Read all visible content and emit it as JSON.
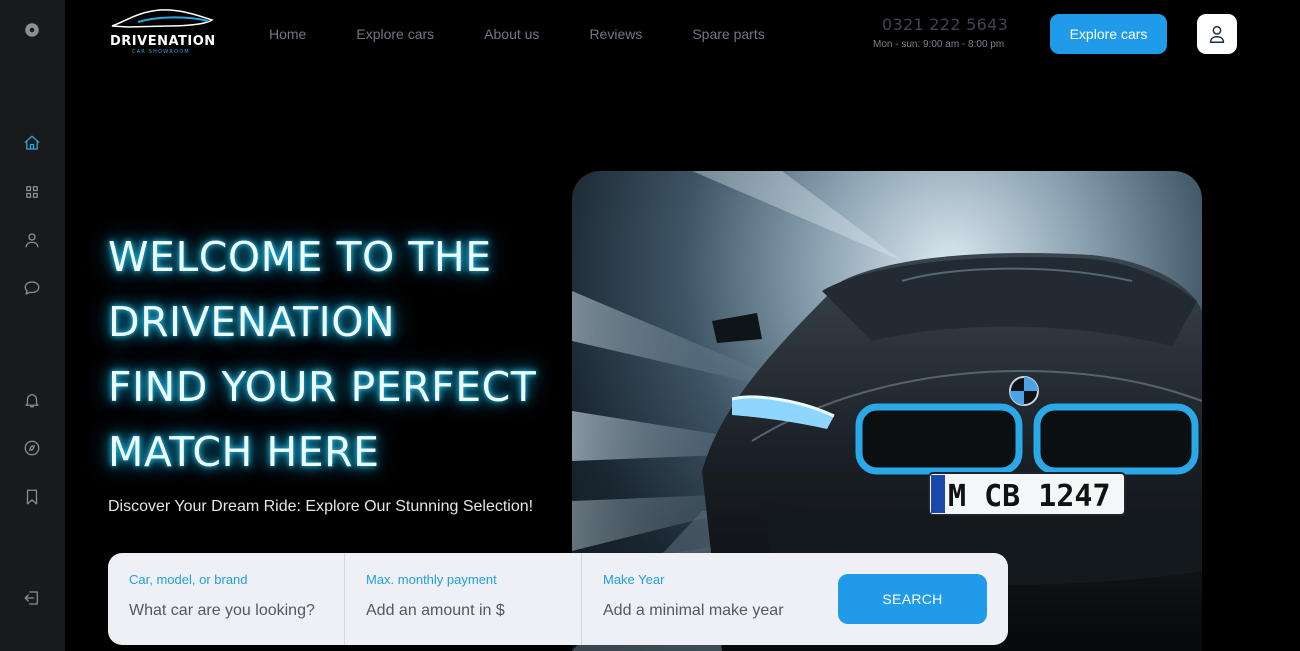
{
  "rail": {
    "top": [
      {
        "icon": "settings-dot-icon"
      }
    ],
    "middle": [
      {
        "icon": "home-icon",
        "active": true
      },
      {
        "icon": "grid-icon"
      },
      {
        "icon": "user-icon"
      },
      {
        "icon": "chat-icon"
      }
    ],
    "lower": [
      {
        "icon": "bell-icon"
      },
      {
        "icon": "compass-icon"
      },
      {
        "icon": "bookmark-icon"
      }
    ],
    "bottom": [
      {
        "icon": "logout-icon"
      }
    ]
  },
  "header": {
    "brand": "DRIVENATION",
    "tagline": "CAR SHOWROOM",
    "nav": [
      "Home",
      "Explore cars",
      "About us",
      "Reviews",
      "Spare parts"
    ],
    "phone": "0321 222 5643",
    "hours": "Mon - sun: 9:00 am - 8:00 pm",
    "cta_label": "Explore cars"
  },
  "hero": {
    "headline_lines": [
      "WELCOME TO THE",
      "DRIVENATION",
      "FIND YOUR PERFECT",
      "MATCH HERE"
    ],
    "subtitle": "Discover Your Dream Ride: Explore Our Stunning Selection!",
    "plate_text": "M CB 1247"
  },
  "search": {
    "fields": [
      {
        "label": "Car, model, or brand",
        "placeholder": "What car are you looking?"
      },
      {
        "label": "Max. monthly payment",
        "placeholder": "Add an amount in $"
      },
      {
        "label": "Make Year",
        "placeholder": "Add a minimal make year"
      }
    ],
    "button_label": "SEARCH"
  },
  "colors": {
    "accent": "#1f9be9",
    "rail_bg": "#191a1c",
    "glow": "#2bd4ff"
  }
}
